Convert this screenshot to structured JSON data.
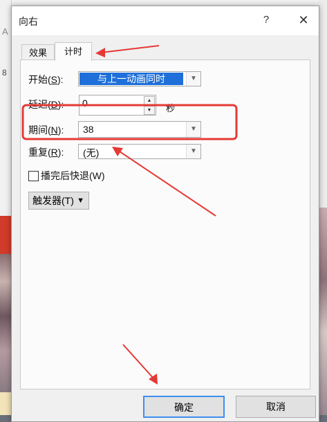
{
  "background": {
    "glyph_a": "A",
    "glyph_8": "8"
  },
  "dialog": {
    "title": "向右",
    "help_label": "?",
    "close_label": "✕",
    "tabs": [
      {
        "label": "效果"
      },
      {
        "label": "计时"
      }
    ],
    "fields": {
      "start": {
        "label_prefix": "开始(",
        "hotkey": "S",
        "label_suffix": "):",
        "value": "与上一动画同时"
      },
      "delay": {
        "label_prefix": "延迟(",
        "hotkey": "D",
        "label_suffix": "):",
        "value": "0",
        "unit": "秒"
      },
      "duration": {
        "label_prefix": "期间(",
        "hotkey": "N",
        "label_suffix": "):",
        "value": "38"
      },
      "repeat": {
        "label_prefix": "重复(",
        "hotkey": "R",
        "label_suffix": "):",
        "value": "(无)"
      }
    },
    "rewind": {
      "label": "播完后快退(W)",
      "checked": false
    },
    "trigger": {
      "label": "触发器(T)",
      "icon": "double-chevron-down-icon"
    },
    "ok_label": "确定",
    "cancel_label": "取消"
  },
  "annotations": {
    "color": "#e53935"
  }
}
